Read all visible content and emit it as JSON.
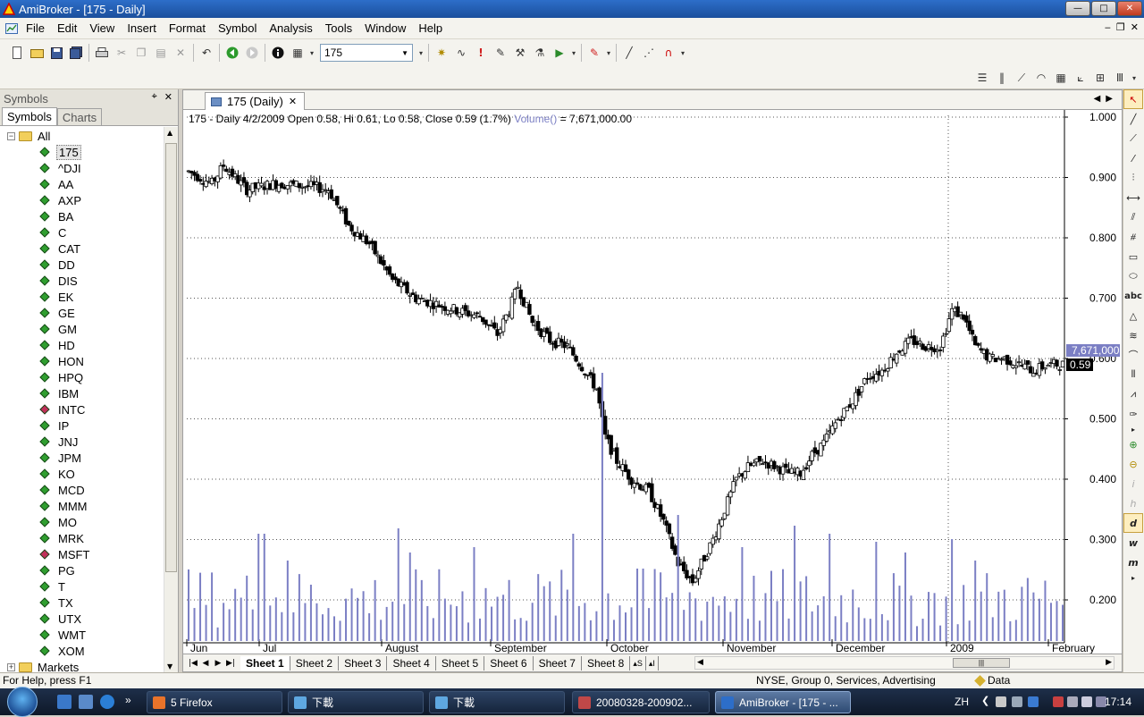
{
  "window": {
    "title": "AmiBroker - [175 - Daily]",
    "min": "—",
    "max": "□",
    "close": "✕"
  },
  "menu": [
    "File",
    "Edit",
    "View",
    "Insert",
    "Format",
    "Symbol",
    "Analysis",
    "Tools",
    "Window",
    "Help"
  ],
  "mdi": {
    "min": "‒",
    "restore": "❐",
    "close": "✕"
  },
  "toolbar": {
    "symbol_value": "175"
  },
  "symbols_panel": {
    "title": "Symbols",
    "pin": "⌖",
    "close": "✕",
    "tabs": [
      "Symbols",
      "Charts"
    ],
    "root": "All",
    "markets": "Markets",
    "items": [
      {
        "label": "175",
        "color": "#2f9e2f"
      },
      {
        "label": "^DJI",
        "color": "#2f9e2f"
      },
      {
        "label": "AA",
        "color": "#2f9e2f"
      },
      {
        "label": "AXP",
        "color": "#2f9e2f"
      },
      {
        "label": "BA",
        "color": "#2f9e2f"
      },
      {
        "label": "C",
        "color": "#2f9e2f"
      },
      {
        "label": "CAT",
        "color": "#2f9e2f"
      },
      {
        "label": "DD",
        "color": "#2f9e2f"
      },
      {
        "label": "DIS",
        "color": "#2f9e2f"
      },
      {
        "label": "EK",
        "color": "#2f9e2f"
      },
      {
        "label": "GE",
        "color": "#2f9e2f"
      },
      {
        "label": "GM",
        "color": "#2f9e2f"
      },
      {
        "label": "HD",
        "color": "#2f9e2f"
      },
      {
        "label": "HON",
        "color": "#2f9e2f"
      },
      {
        "label": "HPQ",
        "color": "#2f9e2f"
      },
      {
        "label": "IBM",
        "color": "#2f9e2f"
      },
      {
        "label": "INTC",
        "color": "#c0305a"
      },
      {
        "label": "IP",
        "color": "#2f9e2f"
      },
      {
        "label": "JNJ",
        "color": "#2f9e2f"
      },
      {
        "label": "JPM",
        "color": "#2f9e2f"
      },
      {
        "label": "KO",
        "color": "#2f9e2f"
      },
      {
        "label": "MCD",
        "color": "#2f9e2f"
      },
      {
        "label": "MMM",
        "color": "#2f9e2f"
      },
      {
        "label": "MO",
        "color": "#2f9e2f"
      },
      {
        "label": "MRK",
        "color": "#2f9e2f"
      },
      {
        "label": "MSFT",
        "color": "#c0305a"
      },
      {
        "label": "PG",
        "color": "#2f9e2f"
      },
      {
        "label": "T",
        "color": "#2f9e2f"
      },
      {
        "label": "TX",
        "color": "#2f9e2f"
      },
      {
        "label": "UTX",
        "color": "#2f9e2f"
      },
      {
        "label": "WMT",
        "color": "#2f9e2f"
      },
      {
        "label": "XOM",
        "color": "#2f9e2f"
      }
    ]
  },
  "chart_window": {
    "tab_label": "175 (Daily)",
    "tab_close": "✕",
    "sheets": [
      "Sheet 1",
      "Sheet 2",
      "Sheet 3",
      "Sheet 4",
      "Sheet 5",
      "Sheet 6",
      "Sheet 7",
      "Sheet 8"
    ],
    "sheet_extra": "▴S",
    "sheet_extra2": "▴I"
  },
  "chart_data": {
    "type": "candlestick",
    "header_text": "175 - Daily 4/2/2009 Open 0.58, Hi 0.61, Lo 0.58, Close 0.59 (1.7%)",
    "volume_label": "Volume()",
    "volume_value": " = 7,671,000.00",
    "y_ticks": [
      "1.000",
      "0.900",
      "0.800",
      "0.700",
      "0.600",
      "0.500",
      "0.400",
      "0.300",
      "0.200"
    ],
    "ylim": [
      0.2,
      1.0
    ],
    "x_labels": [
      "Jun",
      "Jul",
      "August",
      "September",
      "October",
      "November",
      "December",
      "2009",
      "February"
    ],
    "last_volume_label": "7,671,000",
    "last_close_label": "0.59",
    "price_color": "#000000",
    "volume_color": "#7b7fc4",
    "grid": true,
    "waypoints": [
      [
        0,
        0.91
      ],
      [
        8,
        0.89
      ],
      [
        12,
        0.92
      ],
      [
        20,
        0.88
      ],
      [
        30,
        0.89
      ],
      [
        42,
        0.885
      ],
      [
        48,
        0.88
      ],
      [
        55,
        0.82
      ],
      [
        62,
        0.79
      ],
      [
        70,
        0.73
      ],
      [
        78,
        0.7
      ],
      [
        85,
        0.69
      ],
      [
        92,
        0.68
      ],
      [
        100,
        0.67
      ],
      [
        106,
        0.64
      ],
      [
        110,
        0.68
      ],
      [
        113,
        0.72
      ],
      [
        118,
        0.66
      ],
      [
        124,
        0.63
      ],
      [
        130,
        0.62
      ],
      [
        136,
        0.58
      ],
      [
        140,
        0.55
      ],
      [
        143,
        0.47
      ],
      [
        147,
        0.43
      ],
      [
        152,
        0.4
      ],
      [
        158,
        0.38
      ],
      [
        163,
        0.33
      ],
      [
        168,
        0.26
      ],
      [
        173,
        0.23
      ],
      [
        176,
        0.26
      ],
      [
        180,
        0.3
      ],
      [
        184,
        0.35
      ],
      [
        188,
        0.4
      ],
      [
        192,
        0.42
      ],
      [
        197,
        0.43
      ],
      [
        202,
        0.42
      ],
      [
        206,
        0.41
      ],
      [
        210,
        0.41
      ],
      [
        214,
        0.44
      ],
      [
        218,
        0.46
      ],
      [
        223,
        0.5
      ],
      [
        228,
        0.53
      ],
      [
        233,
        0.57
      ],
      [
        238,
        0.58
      ],
      [
        243,
        0.61
      ],
      [
        248,
        0.63
      ],
      [
        253,
        0.62
      ],
      [
        258,
        0.62
      ],
      [
        262,
        0.68
      ],
      [
        266,
        0.67
      ],
      [
        270,
        0.62
      ],
      [
        275,
        0.6
      ],
      [
        280,
        0.6
      ],
      [
        285,
        0.59
      ],
      [
        290,
        0.58
      ],
      [
        295,
        0.59
      ],
      [
        300,
        0.59
      ]
    ],
    "volume_spikes": [
      [
        25,
        0.4
      ],
      [
        34,
        0.3
      ],
      [
        72,
        0.42
      ],
      [
        76,
        0.33
      ],
      [
        98,
        0.35
      ],
      [
        132,
        0.4
      ],
      [
        142,
        1.0
      ],
      [
        155,
        0.27
      ],
      [
        168,
        0.47
      ],
      [
        190,
        0.35
      ],
      [
        208,
        0.43
      ],
      [
        220,
        0.4
      ],
      [
        236,
        0.37
      ],
      [
        246,
        0.33
      ],
      [
        262,
        0.38
      ],
      [
        270,
        0.3
      ]
    ]
  },
  "status": {
    "help": "For Help, press F1",
    "symbol_info": "NYSE, Group 0, Services, Advertising",
    "data": "Data"
  },
  "taskbar": {
    "tasks": [
      {
        "label": "5 Firefox",
        "color": "#e8732a"
      },
      {
        "label": "下載",
        "color": "#5ea7e0"
      },
      {
        "label": "下載",
        "color": "#5ea7e0"
      },
      {
        "label": "20080328-200902...",
        "color": "#c04848"
      },
      {
        "label": "AmiBroker - [175 - ...",
        "color": "#2d6ec9"
      }
    ],
    "lang": "ZH",
    "clock": "17:14"
  }
}
